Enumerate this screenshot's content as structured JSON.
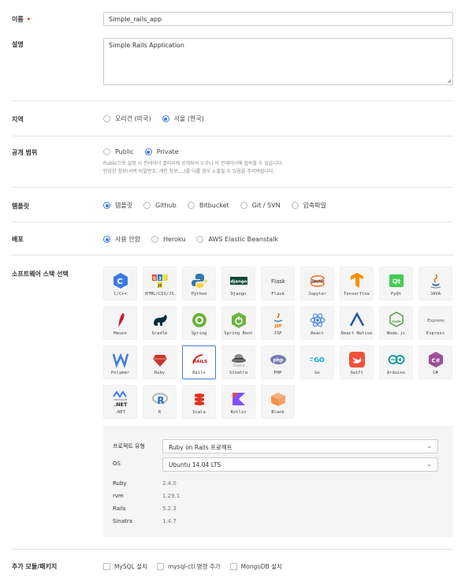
{
  "form": {
    "name_label": "이름",
    "name_required": "•",
    "name_value": "Simple_rails_app",
    "desc_label": "설명",
    "desc_value": "Simple Rails Application",
    "region_label": "지역",
    "regions": [
      {
        "label": "오리건 (미국)",
        "selected": false
      },
      {
        "label": "서울 (한국)",
        "selected": true
      }
    ],
    "visibility_label": "공개 범위",
    "visibility": [
      {
        "label": "Public",
        "selected": false
      },
      {
        "label": "Private",
        "selected": true
      }
    ],
    "visibility_help_1": "Public으로 설정 시 컨테이너 갤러리에 공개되어 누구나 이 컨테이너에 접속할 수 있습니다.",
    "visibility_help_2": "민감한 정보(서버 비밀번호, 개인 정보,...)를 다룰 경우 노출될 수 있음을 주의바랍니다.",
    "template_label": "템플릿",
    "templates": [
      {
        "label": "템플릿",
        "selected": true
      },
      {
        "label": "Github",
        "selected": false
      },
      {
        "label": "Bitbucket",
        "selected": false
      },
      {
        "label": "Git / SVN",
        "selected": false
      },
      {
        "label": "압축파일",
        "selected": false
      }
    ],
    "deploy_label": "배포",
    "deploys": [
      {
        "label": "사용 안함",
        "selected": true
      },
      {
        "label": "Heroku",
        "selected": false
      },
      {
        "label": "AWS Elastic Beanstalk",
        "selected": false
      }
    ],
    "stack_label": "소프트웨어 스택 선택",
    "stacks": [
      {
        "name": "C/C++",
        "icon": "cpp-icon",
        "selected": false
      },
      {
        "name": "HTML/CSS/JS",
        "icon": "html-css-js-icon",
        "selected": false
      },
      {
        "name": "Python",
        "icon": "python-icon",
        "selected": false
      },
      {
        "name": "Django",
        "icon": "django-icon",
        "selected": false
      },
      {
        "name": "Flask",
        "icon": "flask-icon",
        "selected": false
      },
      {
        "name": "Jupyter",
        "icon": "jupyter-icon",
        "selected": false
      },
      {
        "name": "Tensorflow",
        "icon": "tensorflow-icon",
        "selected": false
      },
      {
        "name": "PyQt",
        "icon": "pyqt-icon",
        "selected": false
      },
      {
        "name": "JAVA",
        "icon": "java-icon",
        "selected": false
      },
      {
        "name": "Maven",
        "icon": "maven-icon",
        "selected": false
      },
      {
        "name": "Gradle",
        "icon": "gradle-icon",
        "selected": false
      },
      {
        "name": "Spring",
        "icon": "spring-icon",
        "selected": false
      },
      {
        "name": "Spring Boot",
        "icon": "spring-boot-icon",
        "selected": false
      },
      {
        "name": "JSP",
        "icon": "jsp-icon",
        "selected": false
      },
      {
        "name": "React",
        "icon": "react-icon",
        "selected": false
      },
      {
        "name": "React Native",
        "icon": "react-native-icon",
        "selected": false
      },
      {
        "name": "Node.js",
        "icon": "nodejs-icon",
        "selected": false
      },
      {
        "name": "Express",
        "icon": "express-icon",
        "selected": false
      },
      {
        "name": "Polymer",
        "icon": "polymer-icon",
        "selected": false
      },
      {
        "name": "Ruby",
        "icon": "ruby-icon",
        "selected": false
      },
      {
        "name": "Rails",
        "icon": "rails-icon",
        "selected": true
      },
      {
        "name": "Sinatra",
        "icon": "sinatra-icon",
        "selected": false
      },
      {
        "name": "PHP",
        "icon": "php-icon",
        "selected": false
      },
      {
        "name": "Go",
        "icon": "go-icon",
        "selected": false
      },
      {
        "name": "Swift",
        "icon": "swift-icon",
        "selected": false
      },
      {
        "name": "Arduino",
        "icon": "arduino-icon",
        "selected": false
      },
      {
        "name": "C#",
        "icon": "csharp-icon",
        "selected": false
      },
      {
        "name": ".NET",
        "icon": "dotnet-icon",
        "selected": false
      },
      {
        "name": "R",
        "icon": "r-icon",
        "selected": false
      },
      {
        "name": "Scala",
        "icon": "scala-icon",
        "selected": false
      },
      {
        "name": "Kotlin",
        "icon": "kotlin-icon",
        "selected": false
      },
      {
        "name": "Blank",
        "icon": "blank-box-icon",
        "selected": false
      }
    ],
    "icon_text": {
      "django": "django",
      "flask": "Flask",
      "express": "Express",
      "php": "php",
      "go": "GO",
      "jupyter": "jupyter",
      "pyqt": "Qt",
      "rails": "RAILS",
      "html5": "5",
      "css3": "3",
      "js": "JS",
      "sinatra": "Sinatra",
      "jsp": "JSP",
      "nodejs": "node",
      "dotnet_top": "microsoft",
      "dotnet": ".NET",
      "r": "R",
      "csharp": "C#",
      "cpp": "C"
    },
    "project": {
      "type_label": "프로젝트 유형",
      "type_value": "Ruby on Rails 프로젝트",
      "os_label": "OS",
      "os_value": "Ubuntu 14.04 LTS",
      "versions": [
        {
          "name": "Ruby",
          "version": "2.4.0"
        },
        {
          "name": "rvm",
          "version": "1.29.1"
        },
        {
          "name": "Rails",
          "version": "5.2.3"
        },
        {
          "name": "Sinatra",
          "version": "1.4.7"
        }
      ]
    },
    "packages_label": "추가 모듈/패키지",
    "packages": [
      {
        "label": "MySQL 설치",
        "checked": false
      },
      {
        "label": "mysql-ctl 명령 추가",
        "checked": false
      },
      {
        "label": "MongoDB 설치",
        "checked": false
      }
    ]
  },
  "colors": {
    "accent": "#3d7be0",
    "required": "#e53935",
    "panel_bg": "#f5f5f5"
  }
}
